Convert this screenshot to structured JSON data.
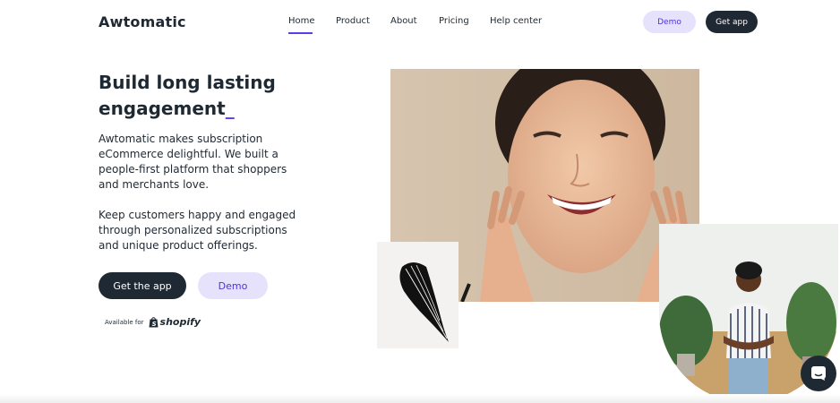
{
  "header": {
    "logo_text": "Awtomatic",
    "nav": [
      {
        "label": "Home",
        "active": true
      },
      {
        "label": "Product",
        "active": false
      },
      {
        "label": "About",
        "active": false
      },
      {
        "label": "Pricing",
        "active": false
      },
      {
        "label": "Help center",
        "active": false
      }
    ],
    "demo_label": "Demo",
    "get_app_label": "Get app"
  },
  "hero": {
    "headline_line1": "Build long lasting",
    "headline_line2": "engagement",
    "headline_cursor": "_",
    "paragraph1": "Awtomatic makes subscription eCommerce delightful. We built a people-first platform that shoppers and merchants love.",
    "paragraph2": "Keep customers happy and engaged through personalized subscriptions and unique product offerings.",
    "get_app_label": "Get the app",
    "demo_label": "Demo",
    "available_for": "Available for",
    "shopify_label": "shopify"
  },
  "colors": {
    "accent": "#5a3ee6",
    "dark": "#1f2933",
    "accent_light": "#e6e2fb"
  },
  "icons": {
    "chat": "chat-icon",
    "shopify_bag": "shopify-bag-icon"
  }
}
